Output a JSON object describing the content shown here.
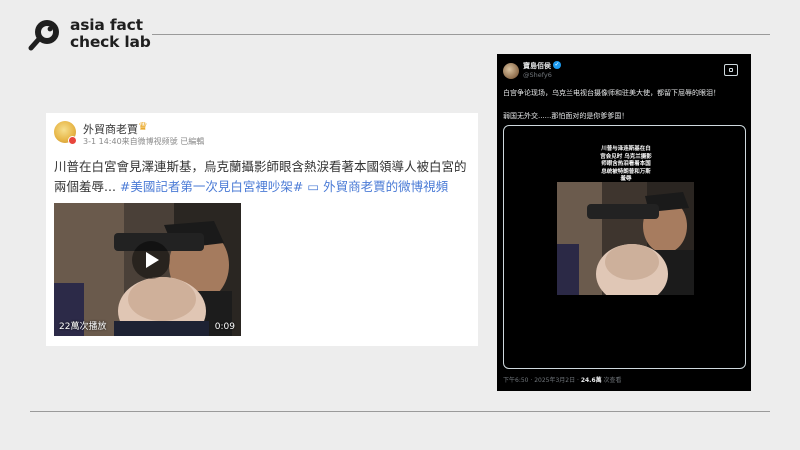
{
  "header": {
    "logo_line1": "asia fact",
    "logo_line2": "check lab"
  },
  "weibo": {
    "username": "外貿商老賈",
    "crown_icon": "crown-icon",
    "meta": "3-1 14:40来自微博视频號 已編輯",
    "text_main": "川普在白宮會見澤連斯基，烏克蘭攝影師眼含熱淚看著本國領導人被白宮的兩個羞辱...",
    "hashtag": "#美國記者第一次見白宮裡吵架#",
    "video_link": "外貿商老賈的微博視頻",
    "video_views": "22萬次播放",
    "video_duration": "0:09"
  },
  "tweet": {
    "username": "寶島佰侯",
    "handle": "@Shefy6",
    "line1": "白宫争论现场，乌克兰电视台摄像师和驻美大使，都留下屈辱的眼泪！",
    "line2": "弱国无外交......那怕面对的是你爹爹国！",
    "caption_lines": [
      "川普与泽连斯基在白",
      "宫会见时 乌克兰摄影",
      "师眼含热泪看着本国",
      "总统被特朗普和万斯",
      "羞辱"
    ],
    "time": "下午6:50 · 2025年3月2日 · ",
    "views_count": "24.6萬",
    "views_label": " 次查看"
  },
  "colors": {
    "link": "#4b7bd6",
    "verified": "#1d9bf0",
    "background": "#ededed"
  }
}
